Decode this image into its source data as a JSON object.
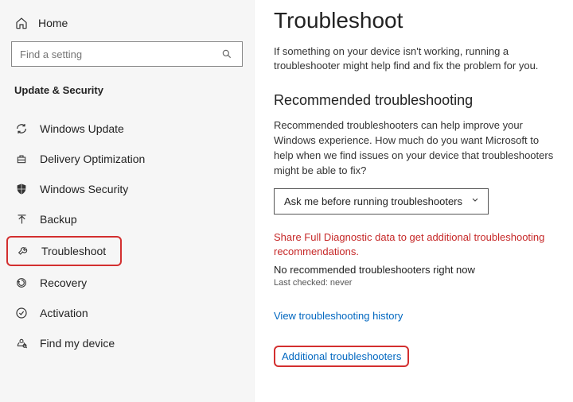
{
  "sidebar": {
    "home_label": "Home",
    "search_placeholder": "Find a setting",
    "section_title": "Update & Security",
    "items": [
      {
        "icon": "sync-icon",
        "label": "Windows Update"
      },
      {
        "icon": "delivery-icon",
        "label": "Delivery Optimization"
      },
      {
        "icon": "shield-icon",
        "label": "Windows Security"
      },
      {
        "icon": "backup-icon",
        "label": "Backup"
      },
      {
        "icon": "wrench-icon",
        "label": "Troubleshoot",
        "selected": true
      },
      {
        "icon": "recovery-icon",
        "label": "Recovery"
      },
      {
        "icon": "check-circle-icon",
        "label": "Activation"
      },
      {
        "icon": "find-device-icon",
        "label": "Find my device"
      }
    ]
  },
  "main": {
    "title": "Troubleshoot",
    "lead": "If something on your device isn't working, running a troubleshooter might help find and fix the problem for you.",
    "section_title": "Recommended troubleshooting",
    "section_desc": "Recommended troubleshooters can help improve your Windows experience. How much do you want Microsoft to help when we find issues on your device that troubleshooters might be able to fix?",
    "dropdown_value": "Ask me before running troubleshooters",
    "warning": "Share Full Diagnostic data to get additional troubleshooting recommendations.",
    "status": "No recommended troubleshooters right now",
    "last_checked": "Last checked: never",
    "history_link": "View troubleshooting history",
    "additional_link": "Additional troubleshooters"
  }
}
